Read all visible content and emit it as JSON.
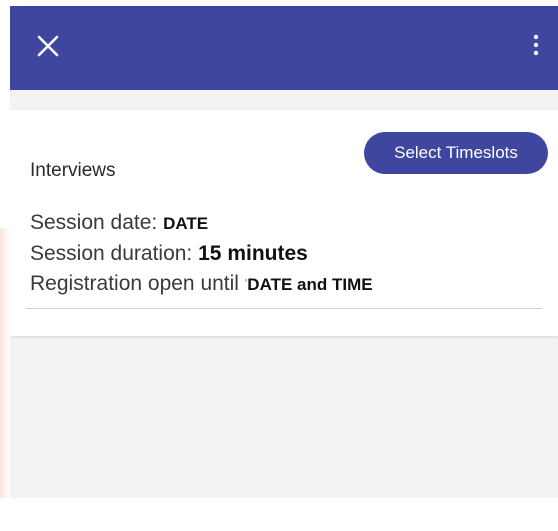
{
  "appbar": {
    "close_icon": "close-icon",
    "more_icon": "more-vertical-icon",
    "background_color": "#3f46a0"
  },
  "card": {
    "title": "Interviews",
    "select_button_label": "Select Timeslots",
    "session_date_label": "Session date:",
    "session_date_value": "DATE",
    "session_duration_label": "Session duration:",
    "session_duration_value": "15 minutes",
    "registration_label": "Registration open until",
    "registration_value": "DATE and TIME"
  }
}
